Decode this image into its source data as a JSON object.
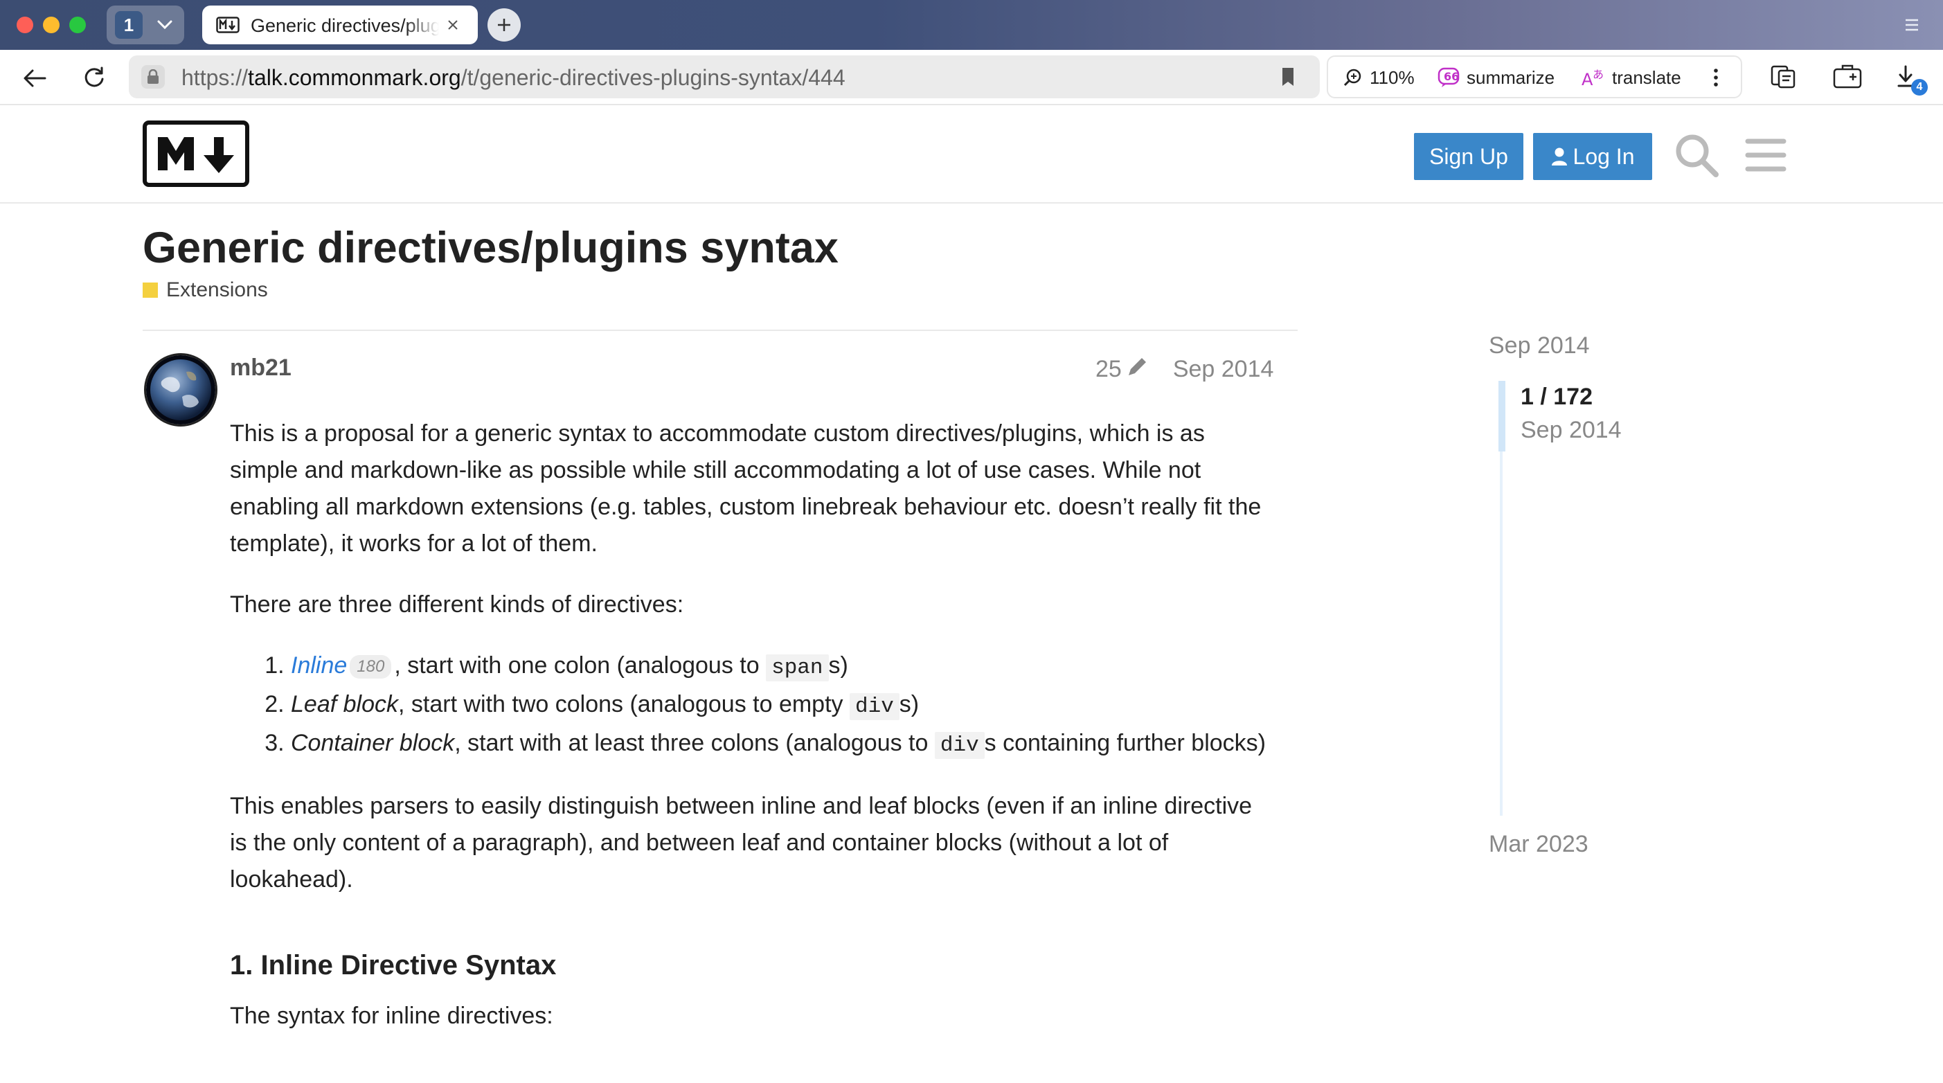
{
  "browser": {
    "tab_count": "1",
    "tab_title": "Generic directives/plugins syntax",
    "url_prefix": "https://",
    "url_host": "talk.commonmark.org",
    "url_path": "/t/generic-directives-plugins-syntax/444",
    "zoom": "110%",
    "summarize_label": "summarize",
    "translate_label": "translate",
    "downloads_badge": "4"
  },
  "header": {
    "signup_label": "Sign Up",
    "login_label": "Log In"
  },
  "topic": {
    "title": "Generic directives/plugins syntax",
    "category": "Extensions",
    "category_color": "#f4d03f"
  },
  "post": {
    "username": "mb21",
    "edit_count": "25",
    "date": "Sep 2014",
    "p1": "This is a proposal for a generic syntax to accommodate custom directives/plugins, which is as simple and markdown-like as possible while still accommodating a lot of use cases. While not enabling all markdown extensions (e.g. tables, custom linebreak behaviour etc. doesn’t really fit the template), it works for a lot of them.",
    "p2": "There are three different kinds of directives:",
    "list": [
      {
        "term": "Inline",
        "clicks": "180",
        "text_a": ", start with one colon (analogous to ",
        "code": "span",
        "text_b": "s)"
      },
      {
        "term": "Leaf block",
        "text_a": ", start with two colons (analogous to empty ",
        "code": "div",
        "text_b": "s)"
      },
      {
        "term": "Container block",
        "text_a": ", start with at least three colons (analogous to ",
        "code": "div",
        "text_b": "s containing further blocks)"
      }
    ],
    "p3": "This enables parsers to easily distinguish between inline and leaf blocks (even if an inline directive is the only content of a paragraph), and between leaf and container blocks (without a lot of lookahead).",
    "h2": "1. Inline Directive Syntax",
    "p4": "The syntax for inline directives:"
  },
  "timeline": {
    "start_date": "Sep 2014",
    "position": "1 / 172",
    "position_date": "Sep 2014",
    "end_date": "Mar 2023"
  },
  "colors": {
    "accent": "#3a87c9",
    "link": "#2a7bd9"
  }
}
